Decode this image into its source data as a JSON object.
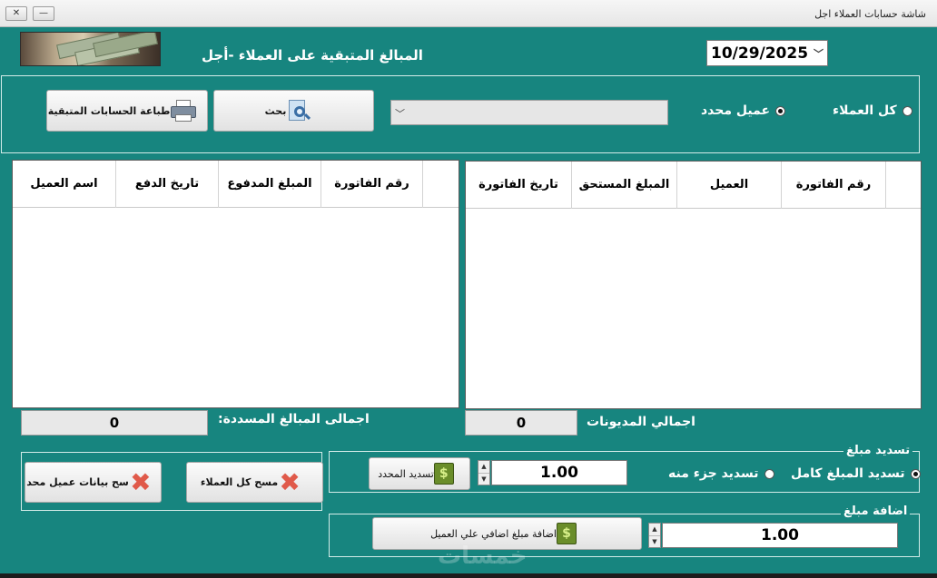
{
  "window": {
    "title": "شاشة حسابات العملاء اجل",
    "minimize_icon": "minimize-icon",
    "restore_icon": "restore-icon"
  },
  "header": {
    "page_title": "المبالغ المتبقية على العملاء -أجل",
    "date": "10/29/2025"
  },
  "filter": {
    "all_customers": "كل العملاء",
    "specific_customer": "عميل محدد",
    "selected": "specific_customer",
    "search_button": "بحث",
    "print_button": "طباعة الحسابات المتبقية"
  },
  "debts_table": {
    "columns": [
      "رقم الفاتورة",
      "العميل",
      "المبلغ المستحق",
      "تاريخ الفاتورة"
    ],
    "rows": []
  },
  "payments_table": {
    "columns": [
      "رقم الفاتورة",
      "المبلغ المدفوع",
      "تاريخ الدفع",
      "اسم العميل"
    ],
    "rows": []
  },
  "totals": {
    "debts_label": "اجمالي المديونات",
    "debts_value": "0",
    "paid_label": "اجمالى المبالغ المسددة:",
    "paid_value": "0"
  },
  "pay_group": {
    "legend": "تسديد مبلغ",
    "full_amount": "تسديد المبلغ كامل",
    "partial_amount": "تسديد جزء منه",
    "selected": "full_amount",
    "amount": "1.00",
    "pay_button": "تسديد المحدد"
  },
  "add_group": {
    "legend": "اضافة مبلغ",
    "amount": "1.00",
    "add_button": "اضافة مبلغ اضافي علي العميل"
  },
  "clear_group": {
    "clear_all_button": "مسح كل العملاء",
    "clear_customer_button": "سح بيانات عميل محد"
  },
  "watermark": "خمسات",
  "colors": {
    "background": "#17857f",
    "panel_border": "#d4ece9",
    "text_light": "#ffffff"
  }
}
